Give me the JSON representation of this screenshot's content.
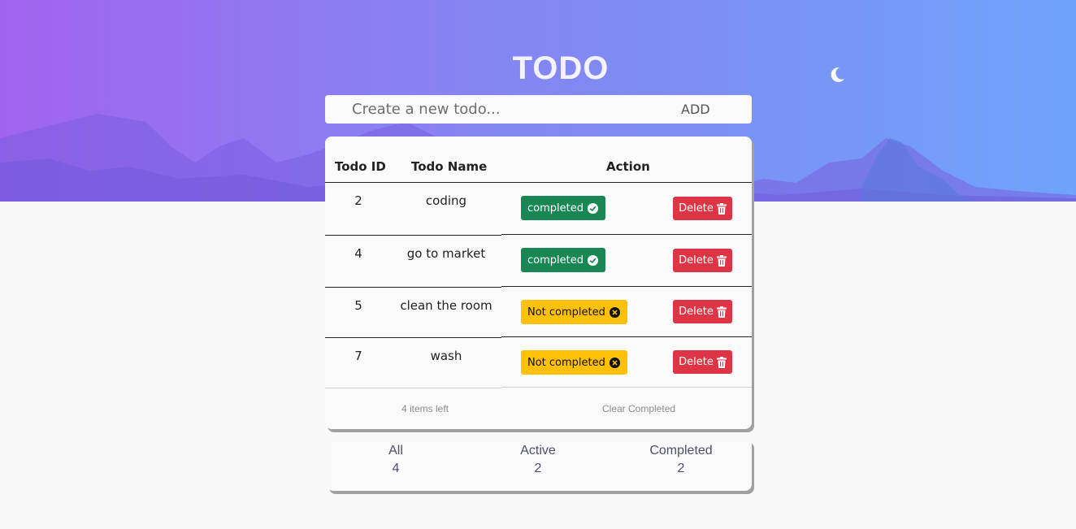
{
  "header": {
    "title": "TODO",
    "theme_toggle_icon": "moon-icon"
  },
  "new_todo": {
    "placeholder": "Create a new todo...",
    "value": "",
    "add_label": "ADD"
  },
  "table": {
    "columns": [
      "Todo ID",
      "Todo Name",
      "Action"
    ],
    "rows": [
      {
        "id": "2",
        "name": "coding",
        "status": "completed",
        "delete": "Delete"
      },
      {
        "id": "4",
        "name": "go to market",
        "status": "completed",
        "delete": "Delete"
      },
      {
        "id": "5",
        "name": "clean the room",
        "status": "Not completed",
        "delete": "Delete"
      },
      {
        "id": "7",
        "name": "wash",
        "status": "Not completed",
        "delete": "Delete"
      }
    ],
    "footer": {
      "items_left": "4 items left",
      "clear_completed": "Clear Completed"
    }
  },
  "filters": [
    {
      "label": "All",
      "count": "4"
    },
    {
      "label": "Active",
      "count": "2"
    },
    {
      "label": "Completed",
      "count": "2"
    }
  ],
  "colors": {
    "completed": "#198754",
    "not_completed": "#ffc107",
    "delete": "#dc3545"
  }
}
